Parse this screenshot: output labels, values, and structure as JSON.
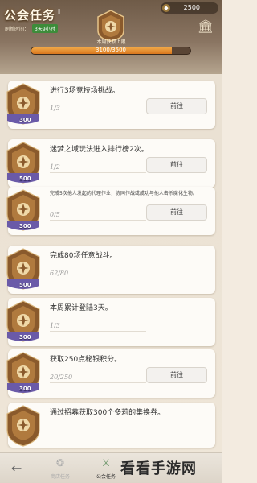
{
  "header": {
    "title": "公会任务",
    "info_icon": "info-icon",
    "refresh_label": "刷新时间：",
    "refresh_time": "3天9小时",
    "currency_value": "2500",
    "currency_icon": "coin-icon",
    "guild_icon": "guild-hall-icon"
  },
  "weekly": {
    "limit_label": "本周获取上限",
    "progress_text": "3100/3500",
    "progress_fraction": 0.886
  },
  "tasks": [
    {
      "title": "进行3场竞技场挑战。",
      "progress": "1/3",
      "reward": "300",
      "button": "前往"
    },
    {
      "title": "迷梦之域玩法进入排行榜2次。",
      "progress": "1/2",
      "reward": "500",
      "button": "前往"
    },
    {
      "title": "完成5次他人发起的代理作业，协同作战或成功与他人击杀魔化生物。",
      "progress": "0/5",
      "reward": "300",
      "button": "前往"
    },
    {
      "title": "完成80场任意战斗。",
      "progress": "62/80",
      "reward": "500",
      "button": ""
    },
    {
      "title": "本周累计登陆3天。",
      "progress": "1/3",
      "reward": "300",
      "button": ""
    },
    {
      "title": "获取250点秘银积分。",
      "progress": "20/250",
      "reward": "300",
      "button": "前往"
    },
    {
      "title": "通过招募获取300个多莉的集换券。",
      "progress": "",
      "reward": "",
      "button": ""
    }
  ],
  "nav": {
    "back_icon": "back-arrow-icon",
    "tab1_label": "商店任务",
    "tab2_label": "公会任务"
  },
  "watermark": "看看手游网",
  "colors": {
    "reward_band": "#6a5aa8",
    "progress_fill": "#e08a2a",
    "emblem_brown": "#8a5a2c"
  }
}
